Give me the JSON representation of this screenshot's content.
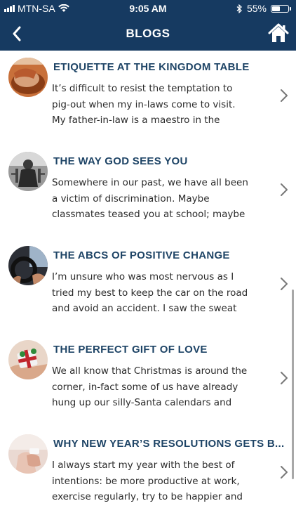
{
  "status_bar": {
    "carrier": "MTN-SA",
    "time": "9:05 AM",
    "battery_percent": "55%",
    "battery_level": 0.55
  },
  "nav": {
    "title": "BLOGS",
    "back_icon": "chevron-left-icon",
    "home_icon": "home-icon"
  },
  "colors": {
    "header_bg": "#163a61",
    "title_text": "#1e4466",
    "body_text": "#2b2b2b"
  },
  "blogs": [
    {
      "title": "ETIQUETTE AT THE KINGDOM TABLE",
      "excerpt_lines": [
        "It’s difficult to resist the temptation to",
        "pig-out when my in-laws come to visit.",
        "My father-in-law is a maestro in the"
      ]
    },
    {
      "title": "THE WAY GOD SEES YOU",
      "excerpt_lines": [
        "Somewhere in our past, we have all been",
        "a victim of discrimination. Maybe",
        "classmates teased you at school; maybe"
      ]
    },
    {
      "title": "THE ABCS OF POSITIVE CHANGE",
      "excerpt_lines": [
        "I’m unsure who was most nervous as I",
        "tried my best to keep the car on the road",
        "and avoid an accident. I saw the sweat"
      ]
    },
    {
      "title": "THE PERFECT GIFT OF LOVE",
      "excerpt_lines": [
        "We all know that Christmas is around the",
        "corner, in-fact some of us have already",
        "hung up our silly-Santa calendars and"
      ]
    },
    {
      "title": "WHY NEW YEAR’S RESOLUTIONS GETS B...",
      "excerpt_lines": [
        "I always start my year with the best of",
        "intentions: be more productive at work,",
        "exercise regularly, try to be happier and"
      ]
    }
  ]
}
